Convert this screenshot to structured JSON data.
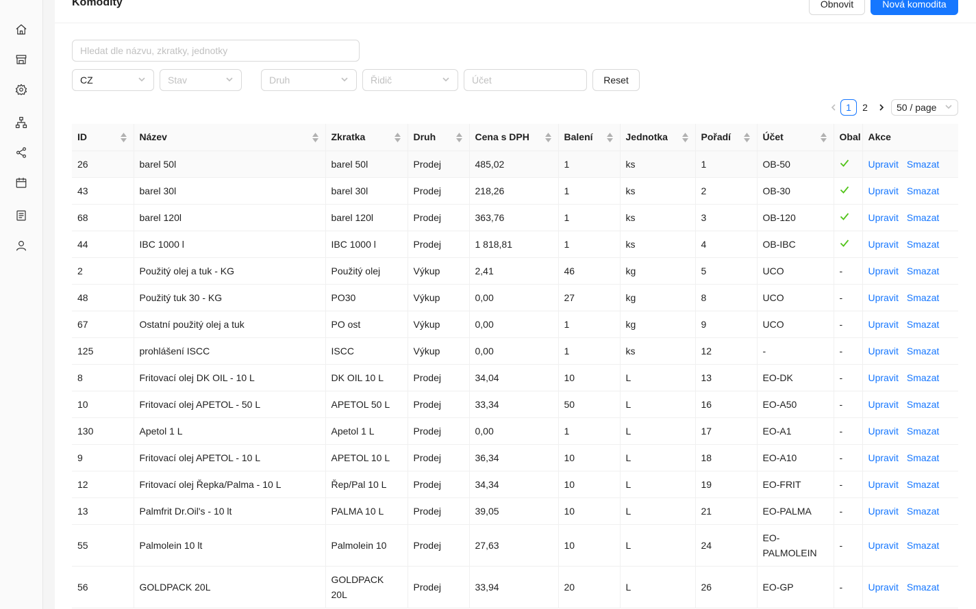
{
  "sidebar": {
    "items": [
      {
        "icon": "home-icon"
      },
      {
        "icon": "shop-icon"
      },
      {
        "icon": "gear-icon"
      },
      {
        "icon": "sitemap-icon"
      },
      {
        "icon": "share-icon"
      },
      {
        "icon": "calendar-icon"
      },
      {
        "icon": "list-icon"
      },
      {
        "icon": "user-icon"
      }
    ]
  },
  "header": {
    "title": "Komodity",
    "refresh_label": "Obnovit",
    "new_label": "Nová komodita"
  },
  "filters": {
    "search_placeholder": "Hledat dle názvu, zkratky, jednotky",
    "country_value": "CZ",
    "stav_placeholder": "Stav",
    "druh_placeholder": "Druh",
    "ridic_placeholder": "Řidič",
    "ucet_placeholder": "Účet",
    "reset_label": "Reset"
  },
  "pagination": {
    "pages": [
      "1",
      "2"
    ],
    "current": "1",
    "page_size": "50 / page"
  },
  "table": {
    "columns": [
      "ID",
      "Název",
      "Zkratka",
      "Druh",
      "Cena s DPH",
      "Balení",
      "Jednotka",
      "Pořadí",
      "Účet",
      "Obal",
      "Akce"
    ],
    "edit_label": "Upravit",
    "delete_label": "Smazat",
    "rows": [
      {
        "id": "26",
        "nazev": "barel 50l",
        "zkratka": "barel 50l",
        "druh": "Prodej",
        "cena": "485,02",
        "baleni": "1",
        "jednotka": "ks",
        "poradi": "1",
        "ucet": "OB-50",
        "obal": "check"
      },
      {
        "id": "43",
        "nazev": "barel 30l",
        "zkratka": "barel 30l",
        "druh": "Prodej",
        "cena": "218,26",
        "baleni": "1",
        "jednotka": "ks",
        "poradi": "2",
        "ucet": "OB-30",
        "obal": "check"
      },
      {
        "id": "68",
        "nazev": "barel 120l",
        "zkratka": "barel 120l",
        "druh": "Prodej",
        "cena": "363,76",
        "baleni": "1",
        "jednotka": "ks",
        "poradi": "3",
        "ucet": "OB-120",
        "obal": "check"
      },
      {
        "id": "44",
        "nazev": "IBC 1000 l",
        "zkratka": "IBC 1000 l",
        "druh": "Prodej",
        "cena": "1 818,81",
        "baleni": "1",
        "jednotka": "ks",
        "poradi": "4",
        "ucet": "OB-IBC",
        "obal": "check"
      },
      {
        "id": "2",
        "nazev": "Použitý olej a tuk - KG",
        "zkratka": "Použitý olej",
        "druh": "Výkup",
        "cena": "2,41",
        "baleni": "46",
        "jednotka": "kg",
        "poradi": "5",
        "ucet": "UCO",
        "obal": "-"
      },
      {
        "id": "48",
        "nazev": "Použitý tuk 30 - KG",
        "zkratka": "PO30",
        "druh": "Výkup",
        "cena": "0,00",
        "baleni": "27",
        "jednotka": "kg",
        "poradi": "8",
        "ucet": "UCO",
        "obal": "-"
      },
      {
        "id": "67",
        "nazev": "Ostatní použitý olej a tuk",
        "zkratka": "PO ost",
        "druh": "Výkup",
        "cena": "0,00",
        "baleni": "1",
        "jednotka": "kg",
        "poradi": "9",
        "ucet": "UCO",
        "obal": "-"
      },
      {
        "id": "125",
        "nazev": "prohlášení ISCC",
        "zkratka": "ISCC",
        "druh": "Výkup",
        "cena": "0,00",
        "baleni": "1",
        "jednotka": "ks",
        "poradi": "12",
        "ucet": "-",
        "obal": "-"
      },
      {
        "id": "8",
        "nazev": "Fritovací olej DK OIL - 10 L",
        "zkratka": "DK OIL 10 L",
        "druh": "Prodej",
        "cena": "34,04",
        "baleni": "10",
        "jednotka": "L",
        "poradi": "13",
        "ucet": "EO-DK",
        "obal": "-"
      },
      {
        "id": "10",
        "nazev": "Fritovací olej APETOL - 50 L",
        "zkratka": "APETOL 50 L",
        "druh": "Prodej",
        "cena": "33,34",
        "baleni": "50",
        "jednotka": "L",
        "poradi": "16",
        "ucet": "EO-A50",
        "obal": "-"
      },
      {
        "id": "130",
        "nazev": "Apetol 1 L",
        "zkratka": "Apetol 1 L",
        "druh": "Prodej",
        "cena": "0,00",
        "baleni": "1",
        "jednotka": "L",
        "poradi": "17",
        "ucet": "EO-A1",
        "obal": "-"
      },
      {
        "id": "9",
        "nazev": "Fritovací olej APETOL - 10 L",
        "zkratka": "APETOL 10 L",
        "druh": "Prodej",
        "cena": "36,34",
        "baleni": "10",
        "jednotka": "L",
        "poradi": "18",
        "ucet": "EO-A10",
        "obal": "-"
      },
      {
        "id": "12",
        "nazev": "Fritovací olej Řepka/Palma - 10 L",
        "zkratka": "Řep/Pal 10 L",
        "druh": "Prodej",
        "cena": "34,34",
        "baleni": "10",
        "jednotka": "L",
        "poradi": "19",
        "ucet": "EO-FRIT",
        "obal": "-"
      },
      {
        "id": "13",
        "nazev": "Palmfrit Dr.Oil's - 10 lt",
        "zkratka": "PALMA 10 L",
        "druh": "Prodej",
        "cena": "39,05",
        "baleni": "10",
        "jednotka": "L",
        "poradi": "21",
        "ucet": "EO-PALMA",
        "obal": "-"
      },
      {
        "id": "55",
        "nazev": "Palmolein 10 lt",
        "zkratka": "Palmolein 10",
        "druh": "Prodej",
        "cena": "27,63",
        "baleni": "10",
        "jednotka": "L",
        "poradi": "24",
        "ucet": "EO-PALMOLEIN",
        "obal": "-"
      },
      {
        "id": "56",
        "nazev": "GOLDPACK 20L",
        "zkratka": "GOLDPACK 20L",
        "druh": "Prodej",
        "cena": "33,94",
        "baleni": "20",
        "jednotka": "L",
        "poradi": "26",
        "ucet": "EO-GP",
        "obal": "-"
      }
    ]
  }
}
